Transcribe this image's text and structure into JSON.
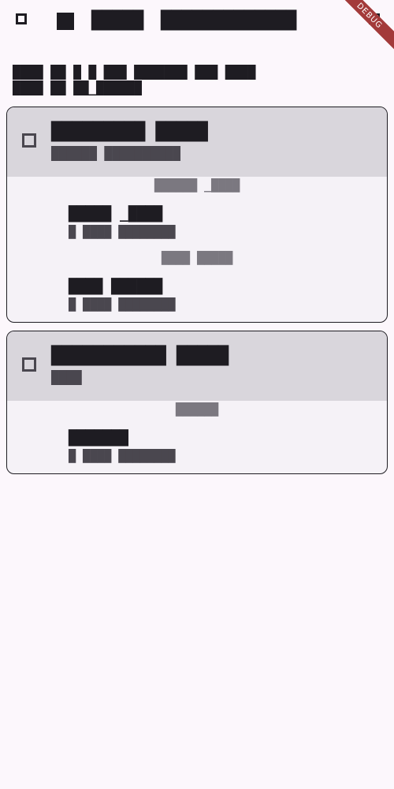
{
  "topbar": {
    "checkbox_label": "",
    "icon": "square-icon",
    "word1": "█████",
    "word2": "█████████████"
  },
  "ribbon": {
    "label": "DEBUG"
  },
  "description": {
    "line1": "████ ██ █ █ ███ ███████ ███ ████",
    "line2": "████ ██ ██_██████"
  },
  "cards": [
    {
      "title_a": "█████████",
      "title_b": "█████",
      "subtitle": "██████ ██████████",
      "sections": [
        {
          "label": "██████ _████",
          "item_name": "█████ _████",
          "item_meta": "█ ████ ████████"
        },
        {
          "label": "████ █████",
          "item_name": "████ ██████",
          "item_meta": "█ ████ ████████"
        }
      ]
    },
    {
      "title_a": "███████████",
      "title_b": "█████",
      "subtitle": "████",
      "sections": [
        {
          "label": "██████",
          "item_name": "███████",
          "item_meta": "█ ████ ████████"
        }
      ]
    }
  ]
}
